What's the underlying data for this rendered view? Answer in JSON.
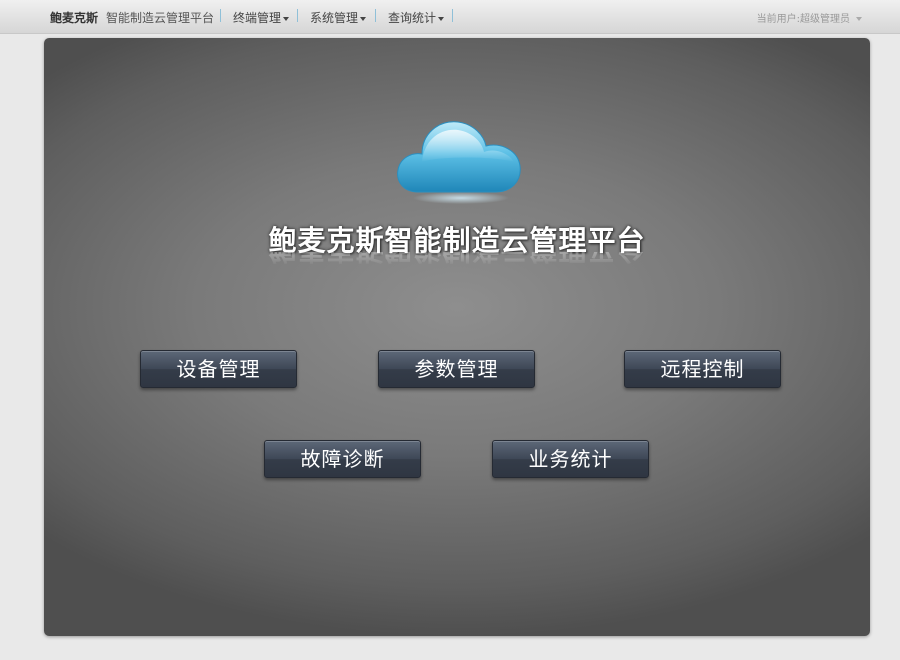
{
  "navbar": {
    "brand": "鲍麦克斯",
    "subtitle": "智能制造云管理平台",
    "menus": [
      {
        "label": "终端管理"
      },
      {
        "label": "系统管理"
      },
      {
        "label": "查询统计"
      }
    ],
    "user": "当前用户:超级管理员"
  },
  "main": {
    "title": "鲍麦克斯智能制造云管理平台",
    "buttons": [
      {
        "label": "设备管理"
      },
      {
        "label": "参数管理"
      },
      {
        "label": "远程控制"
      },
      {
        "label": "故障诊断"
      },
      {
        "label": "业务统计"
      }
    ]
  },
  "icons": {
    "cloud": "cloud-icon",
    "caret": "caret-down-icon"
  },
  "colors": {
    "cloud": "#4fb4dc",
    "button": "#3e4756",
    "separator": "#8fc0d8"
  }
}
